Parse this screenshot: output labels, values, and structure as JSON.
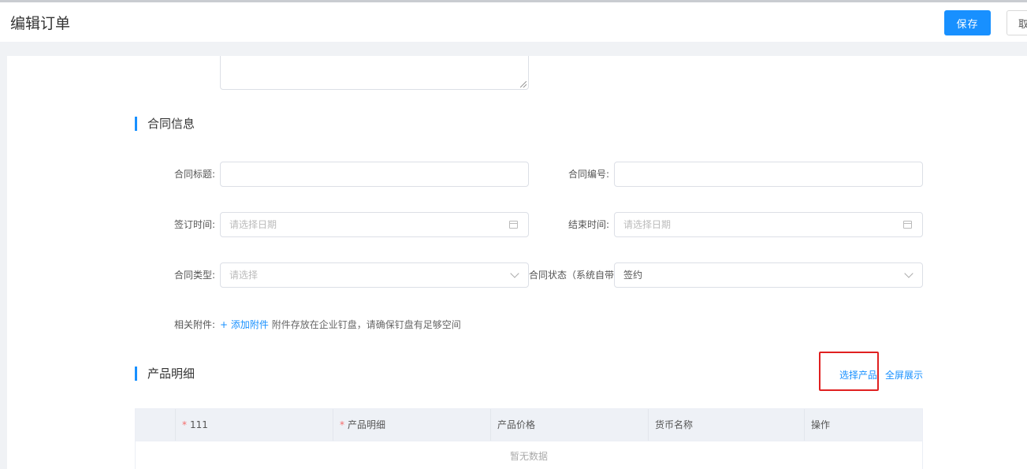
{
  "header": {
    "title": "编辑订单",
    "save_label": "保存",
    "cancel_label": "取消"
  },
  "contract_section": {
    "title": "合同信息",
    "fields": {
      "title_label": "合同标题:",
      "title_value": "",
      "number_label": "合同编号:",
      "number_value": "",
      "sign_date_label": "签订时间:",
      "sign_date_placeholder": "请选择日期",
      "end_date_label": "结束时间:",
      "end_date_placeholder": "请选择日期",
      "type_label": "合同类型:",
      "type_placeholder": "请选择",
      "status_label": "合同状态（系统自带",
      "status_value": "签约",
      "attachment_label": "相关附件:",
      "attachment_link": "+ 添加附件",
      "attachment_hint": "附件存放在企业钉盘，请确保钉盘有足够空间"
    }
  },
  "product_section": {
    "title": "产品明细",
    "select_product_link": "选择产品",
    "fullscreen_link": "全屏展示",
    "table": {
      "columns": [
        {
          "label": "",
          "required": false
        },
        {
          "label": "111",
          "required": true
        },
        {
          "label": "产品明细",
          "required": true
        },
        {
          "label": "产品价格",
          "required": false
        },
        {
          "label": "货币名称",
          "required": false
        },
        {
          "label": "操作",
          "required": false
        }
      ],
      "empty_text": "暂无数据"
    }
  },
  "colors": {
    "primary": "#1890ff",
    "highlight_box": "#e02020",
    "required_star": "#f56c6c"
  }
}
